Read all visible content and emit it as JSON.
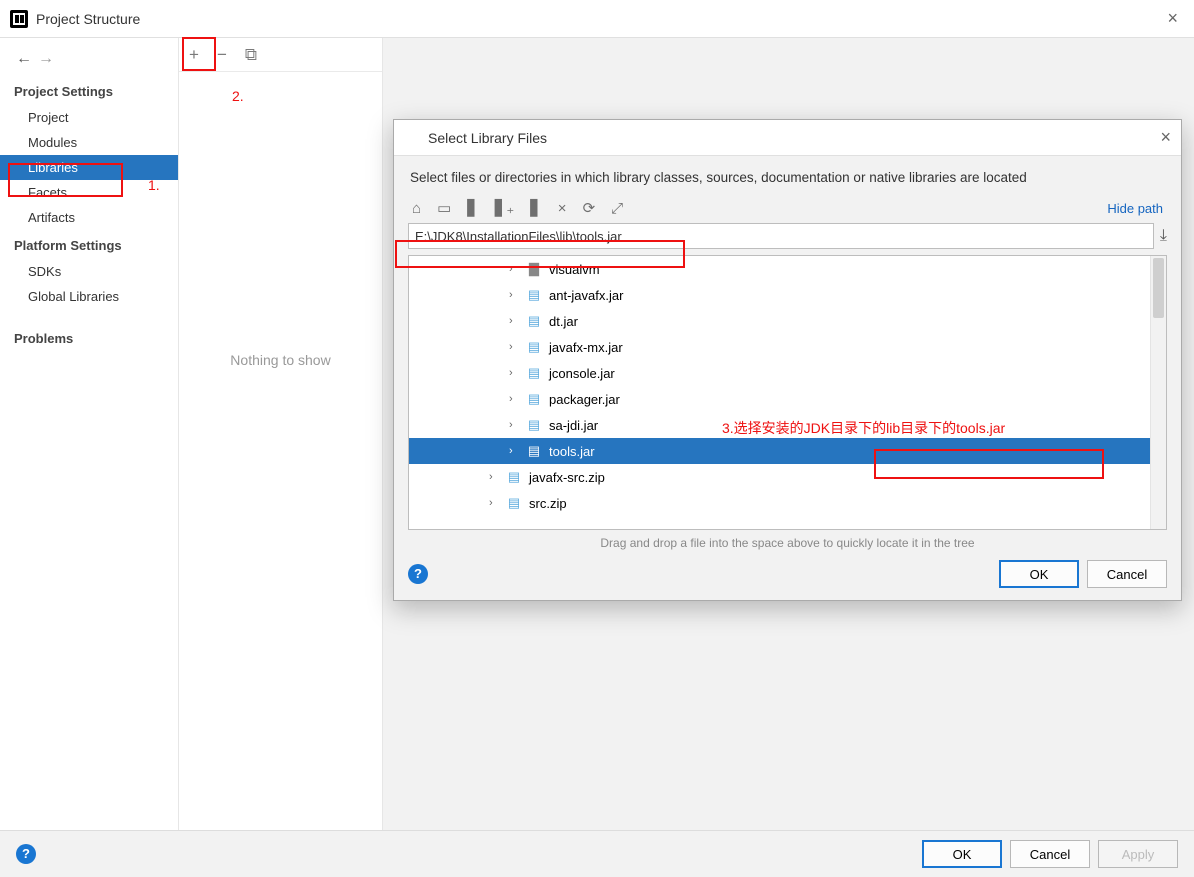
{
  "window": {
    "title": "Project Structure"
  },
  "sidebar": {
    "section1": "Project Settings",
    "items1": [
      "Project",
      "Modules",
      "Libraries",
      "Facets",
      "Artifacts"
    ],
    "section2": "Platform Settings",
    "items2": [
      "SDKs",
      "Global Libraries"
    ],
    "section3": "Problems"
  },
  "center": {
    "nothing": "Nothing to show"
  },
  "toolbar": {
    "add": "+",
    "remove": "−",
    "copy": "⧉"
  },
  "buttons": {
    "ok": "OK",
    "cancel": "Cancel",
    "apply": "Apply"
  },
  "dialog": {
    "title": "Select Library Files",
    "desc": "Select files or directories in which library classes, sources, documentation or native libraries are located",
    "hide_path": "Hide path",
    "path": "E:\\JDK8\\InstallationFiles\\lib\\tools.jar",
    "tree": [
      {
        "name": "visualvm",
        "type": "folder",
        "indent": 1
      },
      {
        "name": "ant-javafx.jar",
        "type": "jar",
        "indent": 1
      },
      {
        "name": "dt.jar",
        "type": "jar",
        "indent": 1
      },
      {
        "name": "javafx-mx.jar",
        "type": "jar",
        "indent": 1
      },
      {
        "name": "jconsole.jar",
        "type": "jar",
        "indent": 1
      },
      {
        "name": "packager.jar",
        "type": "jar",
        "indent": 1
      },
      {
        "name": "sa-jdi.jar",
        "type": "jar",
        "indent": 1
      },
      {
        "name": "tools.jar",
        "type": "jar",
        "indent": 1,
        "selected": true
      },
      {
        "name": "javafx-src.zip",
        "type": "zip",
        "indent": 0
      },
      {
        "name": "src.zip",
        "type": "zip",
        "indent": 0
      }
    ],
    "hint": "Drag and drop a file into the space above to quickly locate it in the tree",
    "ok": "OK",
    "cancel": "Cancel"
  },
  "annotations": {
    "a1": "1.",
    "a2": "2.",
    "a3": "3.选择安装的JDK目录下的lib目录下的tools.jar"
  }
}
